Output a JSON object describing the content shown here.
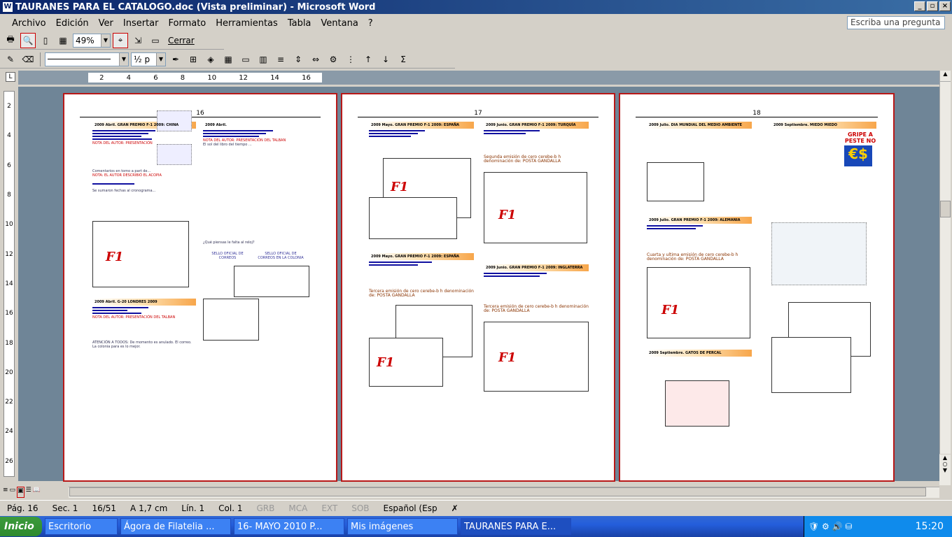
{
  "window": {
    "title": "TAURANES PARA EL CATALOGO.doc (Vista preliminar) - Microsoft Word",
    "min": "_",
    "max": "▫",
    "close": "×"
  },
  "menu": [
    "Archivo",
    "Edición",
    "Ver",
    "Insertar",
    "Formato",
    "Herramientas",
    "Tabla",
    "Ventana",
    "?"
  ],
  "ask_placeholder": "Escriba una pregunta",
  "toolbar": {
    "zoom": "49%",
    "close_label": "Cerrar",
    "style_combo": "",
    "size_combo": "½ p"
  },
  "ruler": {
    "ticks": [
      "2",
      "4",
      "6",
      "8",
      "10",
      "12",
      "14",
      "16"
    ]
  },
  "vruler": {
    "ticks": [
      "2",
      "4",
      "6",
      "8",
      "10",
      "12",
      "14",
      "16",
      "18",
      "20",
      "22",
      "24",
      "26"
    ]
  },
  "pages": [
    {
      "num": "16",
      "articles": [
        "2009 Abril.  GRAN PREMIO F-1 2009: CHINA",
        "2009 Abril.  G-20 LONDRES 2009"
      ],
      "notes": [
        "NOTA DEL AUTOR: PRESENTACIÓN",
        "NOTA: EL AUTOR DESCRIBIÓ EL ACOPIA",
        "NOTA DEL AUTOR: PRESENTACIÓN DEL TALBAN",
        "SELLO OFICIAL DE CORREOS",
        "SELLO OFICIAL DE CORREOS EN LA COLONIA",
        "¿Qué piensas le falta al reloj?",
        "ATENCIÓN A TODOS: De momento es anulado. El correo. La colonia para es lo mejor."
      ]
    },
    {
      "num": "17",
      "articles": [
        "2009 Mayo.  GRAN PREMIO F-1 2009: ESPAÑA",
        "2009 Junio.  GRAN PREMIO F-1 2009: TURQUÍA",
        "2009 Mayo.  GRAN PREMIO F-1 2009: ESPAÑA",
        "2009 Junio.  GRAN PREMIO F-1 2009: INGLATERRA"
      ],
      "notes": [
        "Segunda emisión de cero cerebe-b h denominación de:  POSTA GANDALLA",
        "Tercera emisión de cero cerebe-b h denominación de:  POSTA GANDALLA",
        "Tercera emisión de cero cerebe-b h denominación de:  POSTA GANDALLA"
      ]
    },
    {
      "num": "18",
      "articles": [
        "2009 Julio.  DIA MUNDIAL DEL MEDIO AMBIENTE",
        "2009 Septiembre.  MIEDO MIEDO",
        "2009 Julio.  GRAN PREMIO F-1 2009: ALEMANIA",
        "2009 Septiembre.  GATOS DE PERCAL"
      ],
      "notes": [
        "Cuarta y ultima emisión de cero cerebe-b h denominación de:  POSTA GANDALLA",
        "GRIPE A",
        "PESTE NO"
      ]
    }
  ],
  "status": {
    "page": "Pág. 16",
    "section": "Sec. 1",
    "pages": "16/51",
    "at": "A 1,7 cm",
    "line": "Lín. 1",
    "col": "Col. 1",
    "grb": "GRB",
    "mca": "MCA",
    "ext": "EXT",
    "sob": "SOB",
    "lang": "Español (Esp"
  },
  "taskbar": {
    "start": "Inicio",
    "items": [
      "Escritorio",
      "Ágora de Filatelia ...",
      "16- MAYO 2010  P...",
      "Mis imágenes",
      "TAURANES PARA E..."
    ],
    "clock": "15:20"
  }
}
